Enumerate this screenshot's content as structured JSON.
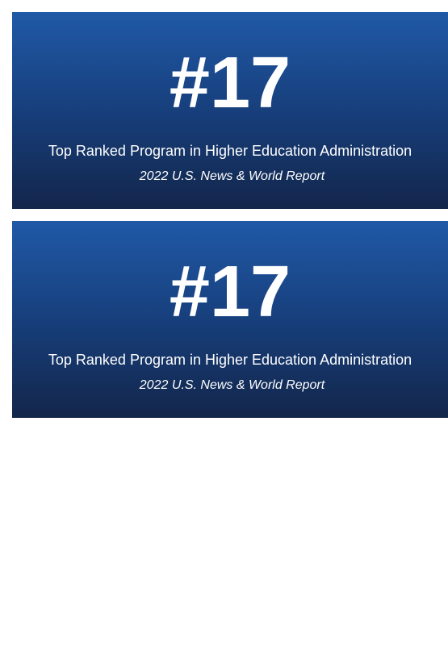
{
  "cards": [
    {
      "rank": "#17",
      "title": "Top Ranked Program in Higher Education Administration",
      "source": "2022 U.S. News & World Report"
    },
    {
      "rank": "#17",
      "title": "Top Ranked Program in Higher Education Administration",
      "source": "2022 U.S. News & World Report"
    }
  ],
  "colors": {
    "gradient_top": "#2059a7",
    "gradient_mid": "#173f7c",
    "gradient_bottom": "#13264b",
    "text": "#ffffff",
    "page_background": "#ffffff"
  }
}
